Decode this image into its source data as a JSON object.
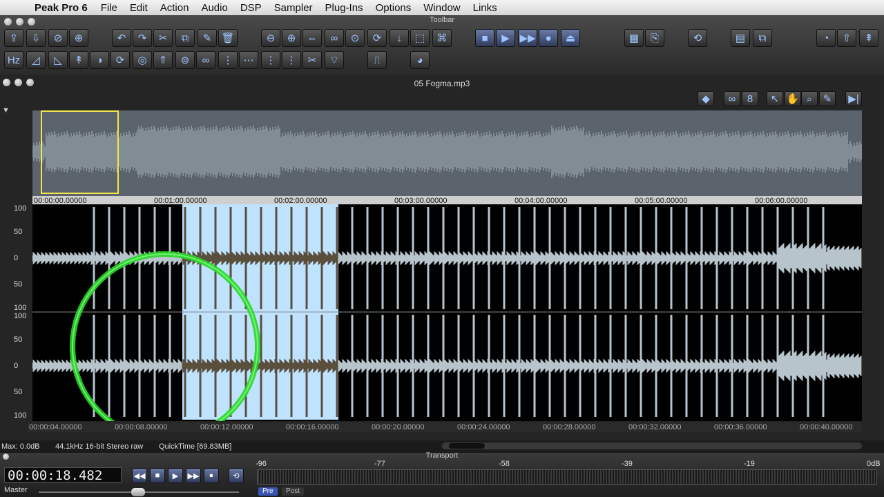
{
  "menubar": {
    "app_name": "Peak Pro 6",
    "items": [
      "File",
      "Edit",
      "Action",
      "Audio",
      "DSP",
      "Sampler",
      "Plug-Ins",
      "Options",
      "Window",
      "Links"
    ]
  },
  "toolbar": {
    "title": "Toolbar"
  },
  "document": {
    "title": "05 Fogma.mp3"
  },
  "overview": {
    "ruler_labels": [
      "00:00:00.00000",
      "00:01:00.00000",
      "00:02:00.00000",
      "00:03:00.00000",
      "00:04:00.00000",
      "00:05:00.00000",
      "00:06:00.00000"
    ]
  },
  "waveform": {
    "y_labels_top": [
      "100",
      "50",
      "0",
      "50",
      "100"
    ],
    "y_labels_bottom": [
      "100",
      "50",
      "0",
      "50",
      "100"
    ],
    "ruler_labels": [
      "00:00:04.00000",
      "00:00:08.00000",
      "00:00:12.00000",
      "00:00:16.00000",
      "00:00:20.00000",
      "00:00:24.00000",
      "00:00:28.00000",
      "00:00:32.00000",
      "00:00:36.00000",
      "00:00:40.00000"
    ]
  },
  "status": {
    "max": "Max: 0.0dB",
    "format": "44.1kHz 16-bit Stereo raw",
    "file": "QuickTime [69.83MB]"
  },
  "transport": {
    "title": "Transport",
    "time": "00:00:18.482",
    "master_label": "Master",
    "meter_scale": [
      "-96",
      "-77",
      "-58",
      "-39",
      "-19",
      "0dB"
    ],
    "pre_label": "Pre",
    "post_label": "Post"
  },
  "colors": {
    "selection": "#bfe3ff",
    "wave": "#b8c4cc",
    "highlight_circle": "#2bd62b",
    "overview_box": "#f2e84a"
  }
}
